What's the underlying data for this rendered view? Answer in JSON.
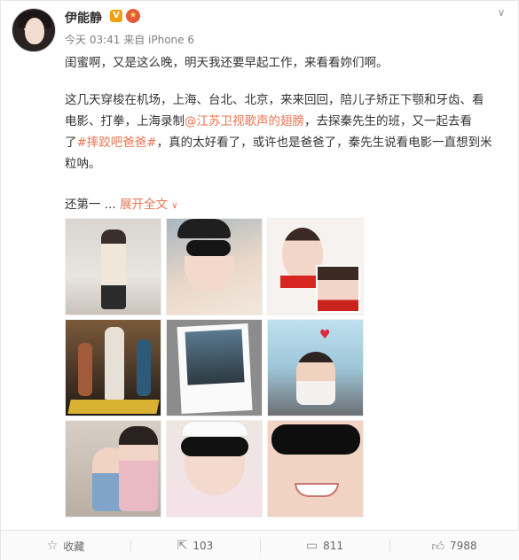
{
  "post": {
    "username": "伊能静",
    "vip_badge": "V",
    "medal_icon": "medal-icon",
    "meta": "今天 03:41 来自 iPhone 6",
    "line1": "闺蜜啊，又是这么晚，明天我还要早起工作，来看看妳们啊。",
    "line2a": "这几天穿梭在机场，上海、台北、北京，来来回回，陪儿子矫正下颚和牙齿、看",
    "line2b_pre": "电影、打拳，上海录制",
    "mention": "@江苏卫视歌声的翅膀",
    "line2b_post": "，去探秦先生的班，又一起去看",
    "line2c_pre": "了",
    "topic": "#摔跤吧爸爸#",
    "line2c_post": "，真的太好看了，或许也是爸爸了，秦先生说看电影一直想到米",
    "line2d": "粒呐。",
    "more_prefix": "还第一 ...",
    "expand": "展开全文",
    "expand_arrow": "∨"
  },
  "footer": {
    "favorite_label": "收藏",
    "repost_count": "103",
    "comment_count": "811",
    "like_count": "7988"
  },
  "colors": {
    "link": "#eb7350",
    "meta": "#808080",
    "text": "#333333"
  }
}
